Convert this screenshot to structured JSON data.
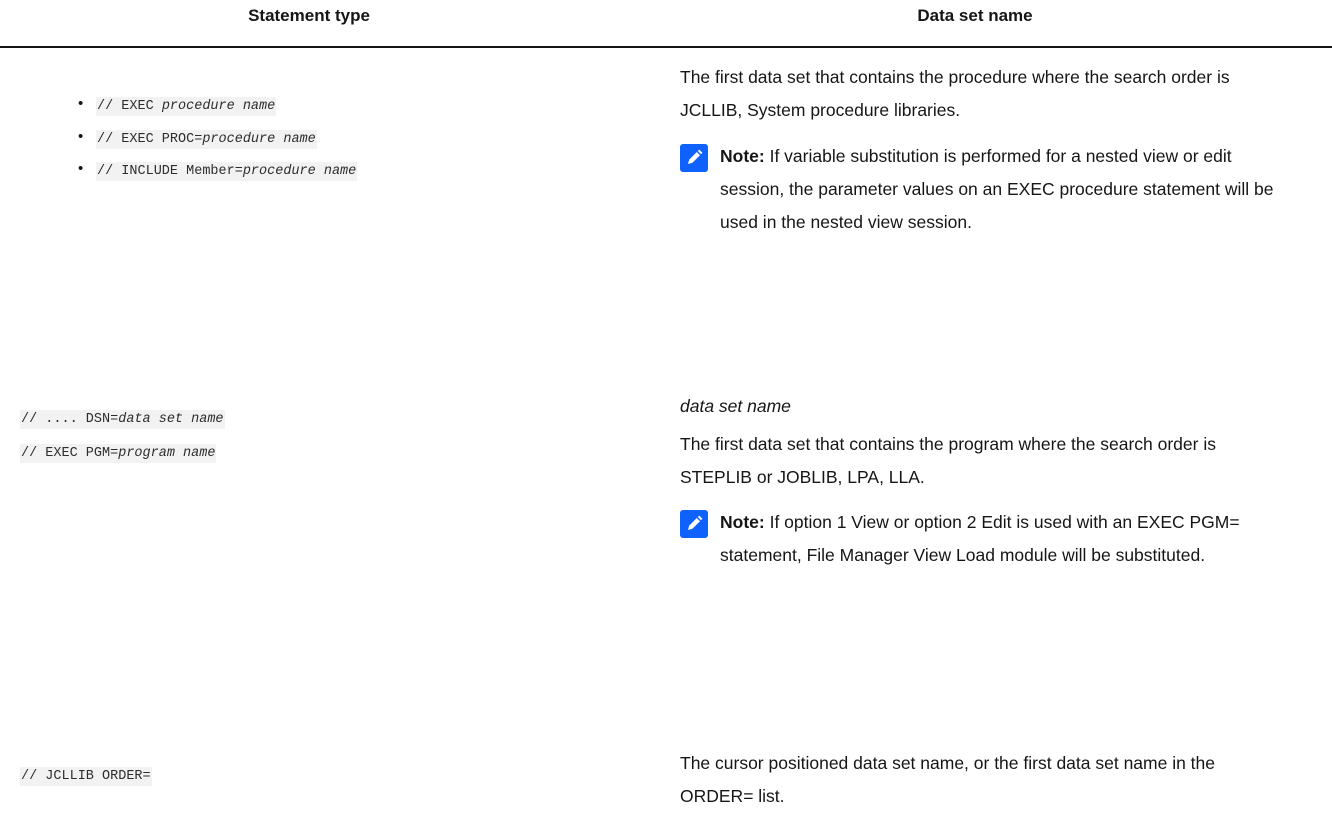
{
  "table": {
    "headers": [
      "Statement type",
      "Data set name"
    ],
    "rows": [
      {
        "statements": [
          {
            "prefix": "// EXEC ",
            "var": "procedure name"
          },
          {
            "prefix": "// EXEC PROC=",
            "var": "procedure name"
          },
          {
            "prefix": "// INCLUDE Member=",
            "var": "procedure name"
          }
        ],
        "dataset_text": "The first data set that contains the procedure where the search order is JCLLIB, System procedure libraries.",
        "note_label": "Note:",
        "note_text": " If variable substitution is performed for a nested view or edit session, the parameter values on an EXEC procedure statement will be used in the nested view session."
      },
      {
        "statement_prefix": "// .... DSN=",
        "statement_var": "data set name",
        "dataset_text": "data set name"
      },
      {
        "statement_prefix": "// EXEC PGM=",
        "statement_var": "program name",
        "dataset_text": "The first data set that contains the program where the search order is STEPLIB or JOBLIB, LPA, LLA.",
        "note_label": "Note:",
        "note_text": " If option 1 View or option 2 Edit is used with an EXEC PGM= statement, File Manager View Load module will be substituted."
      },
      {
        "statement_prefix": "// JCLLIB ORDER=",
        "dataset_text": "The cursor positioned data set name, or the first data set name in the ORDER= list."
      }
    ]
  },
  "icons": {
    "note": "pencil-note-icon"
  },
  "colors": {
    "note_icon_bg": "#0f62fe",
    "rule": "#161616",
    "code_bg": "#f2f2f2"
  }
}
